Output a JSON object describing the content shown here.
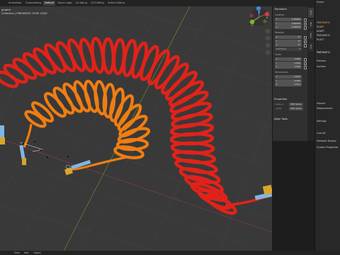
{
  "topbar": {
    "tabs": [
      "Animation",
      "Compositing",
      "Default",
      "Game Logic",
      "Scripting",
      "UV Editing",
      "Video Editing"
    ],
    "active_tab": "Default",
    "scene_label": "Scene"
  },
  "viewport": {
    "overlay_mode": "graphic",
    "overlay_collection": "Collection | PNEUMATIC HOSE LONG",
    "gizmo_axes": [
      "X",
      "Y",
      "Z"
    ],
    "bottom_controls": [
      "View",
      "Add",
      "Object"
    ]
  },
  "npanel": {
    "transform": {
      "header": "Transform",
      "location_label": "Location",
      "location": {
        "x": "1.05080",
        "y": "0.69008",
        "z": "0.00000"
      },
      "rotation_label": "Rotation",
      "rotation": {
        "x": "0°",
        "y": "0°",
        "z": "0°"
      },
      "mode": "XYZ Euler",
      "scale_label": "Scale",
      "scale": {
        "x": "1.000",
        "y": "1.000",
        "z": "1.000"
      },
      "dimensions_label": "Dimensions",
      "dimensions": {
        "x": "5.647",
        "y": "4.403",
        "z": "1.511"
      }
    },
    "properties": {
      "header": "Properties",
      "rows": [
        {
          "name": "cycles_vi...",
          "button": "Edit Value"
        },
        {
          "name": "_cycles",
          "button": "Edit Value"
        }
      ]
    },
    "align_tools": "Align Tools"
  },
  "vtabs": [
    "Item",
    "Tool",
    "View",
    "Edit"
  ],
  "right_panel": {
    "scene_label": "Scene",
    "outliner_items": [
      "PNEUMATIC",
      "PLAST",
      "ADAPT",
      "PNEUMATIC",
      "PLAST"
    ],
    "properties_header": "PNEUMATIC",
    "sections": [
      "Preview",
      "Surface",
      "Volume",
      "Displacement",
      "Settings",
      "Line Art",
      "Viewport Display",
      "Custom Properties"
    ]
  },
  "colors": {
    "viewport_bg": "#393939",
    "hose_red": "#e0231a",
    "hose_orange": "#f07d12",
    "fitting_brass": "#d9a52a",
    "sleeve_blue": "#7fb6e6",
    "x_axis": "#c8404a",
    "y_axis": "#7fb52a",
    "z_axis": "#4a85d4"
  }
}
